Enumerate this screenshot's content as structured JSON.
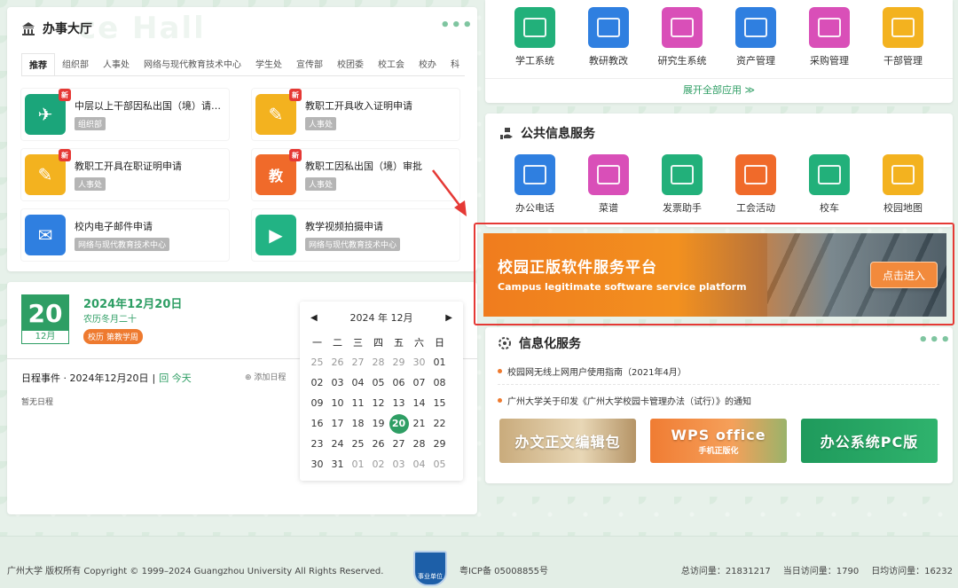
{
  "office_hall": {
    "title": "办事大厅",
    "watermark": "ce Hall",
    "more": "•••",
    "tabs": [
      "推荐",
      "组织部",
      "人事处",
      "网络与现代教育技术中心",
      "学生处",
      "宣传部",
      "校团委",
      "校工会",
      "校办",
      "科"
    ],
    "services": [
      {
        "name": "中层以上干部因私出国（境）请假...",
        "dept": "组织部",
        "is_new": true,
        "new_label": "新",
        "color": "#1ba57a"
      },
      {
        "name": "教职工开具收入证明申请",
        "dept": "人事处",
        "is_new": true,
        "new_label": "新",
        "color": "#f3b21f"
      },
      {
        "name": "教职工开具在职证明申请",
        "dept": "人事处",
        "is_new": true,
        "new_label": "新",
        "color": "#f3b21f"
      },
      {
        "name": "教职工因私出国（境）审批",
        "dept": "人事处",
        "is_new": true,
        "new_label": "新",
        "color": "#f06a2a",
        "glyph": "教"
      },
      {
        "name": "校内电子邮件申请",
        "dept": "网络与现代教育技术中心",
        "is_new": false,
        "color": "#2f7fe0"
      },
      {
        "name": "教学视频拍摄申请",
        "dept": "网络与现代教育技术中心",
        "is_new": false,
        "color": "#22b384"
      }
    ]
  },
  "schedule": {
    "day": "20",
    "month": "12月",
    "date_full": "2024年12月20日",
    "lunar": "农历冬月二十",
    "event_badge": "校历 第教学周",
    "events_label": "日程事件 · 2024年12月20日",
    "divider": "|",
    "today_link": "回 今天",
    "add_label": "⊕ 添加日程",
    "empty": "暂无日程",
    "calendar": {
      "title": "2024 年 12月",
      "prev": "◀",
      "next": "▶",
      "weekdays": [
        "一",
        "二",
        "三",
        "四",
        "五",
        "六",
        "日"
      ],
      "days": [
        "25",
        "26",
        "27",
        "28",
        "29",
        "30",
        "01",
        "02",
        "03",
        "04",
        "05",
        "06",
        "07",
        "08",
        "09",
        "10",
        "11",
        "12",
        "13",
        "14",
        "15",
        "16",
        "17",
        "18",
        "19",
        "20",
        "21",
        "22",
        "23",
        "24",
        "25",
        "26",
        "27",
        "28",
        "29",
        "30",
        "31",
        "01",
        "02",
        "03",
        "04",
        "05"
      ],
      "muted_indices": [
        0,
        1,
        2,
        3,
        4,
        5,
        37,
        38,
        39,
        40,
        41
      ],
      "selected_index": 25
    }
  },
  "apps": {
    "items": [
      {
        "label": "学工系统",
        "color": "#22b07a"
      },
      {
        "label": "教研教改",
        "color": "#2f7fe0"
      },
      {
        "label": "研究生系统",
        "color": "#d94fb8"
      },
      {
        "label": "资产管理",
        "color": "#2f7fe0"
      },
      {
        "label": "采购管理",
        "color": "#d94fb8"
      },
      {
        "label": "干部管理",
        "color": "#f3b21f"
      }
    ],
    "expand": "展开全部应用 ≫"
  },
  "public_info": {
    "title": "公共信息服务",
    "items": [
      {
        "label": "办公电话",
        "color": "#2f7fe0"
      },
      {
        "label": "菜谱",
        "color": "#d94fb8"
      },
      {
        "label": "发票助手",
        "color": "#22b07a"
      },
      {
        "label": "工会活动",
        "color": "#f06a2a"
      },
      {
        "label": "校车",
        "color": "#22b07a"
      },
      {
        "label": "校园地图",
        "color": "#f3b21f"
      }
    ]
  },
  "banner": {
    "title": "校园正版软件服务平台",
    "subtitle": "Campus legitimate software service platform",
    "button": "点击进入"
  },
  "info_service": {
    "title": "信息化服务",
    "more": "•••",
    "news": [
      "校园网无线上网用户使用指南（2021年4月）",
      "广州大学关于印发《广州大学校园卡管理办法（试行）》的通知"
    ],
    "promos": [
      {
        "line1": "办文正文编辑包",
        "line2": ""
      },
      {
        "line1": "WPS office",
        "line2": "手机正版化"
      },
      {
        "line1": "办公系统PC版",
        "line2": ""
      }
    ]
  },
  "footer": {
    "copyright": "广州大学 版权所有 Copyright © 1999–2024 Guangzhou University All Rights Reserved.",
    "emblem_text": "事业单位",
    "icp": "粤ICP备 05008855号",
    "total_visits": "总访问量：21831217",
    "today_visits": "当日访问量：1790",
    "daily_visits": "日均访问量：16232"
  }
}
